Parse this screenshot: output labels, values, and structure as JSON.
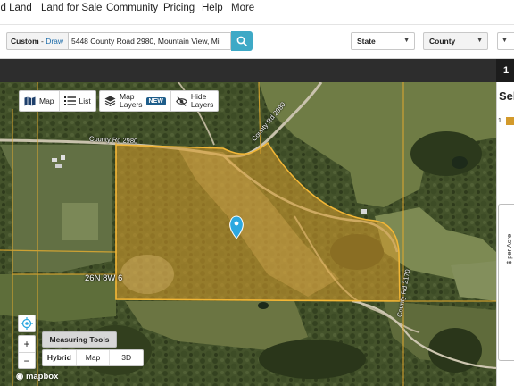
{
  "nav": {
    "links": [
      "ld Land",
      "Land for Sale",
      "Community",
      "Pricing",
      "Help",
      "More"
    ]
  },
  "search": {
    "mode_label": "Custom",
    "mode_sep": " - ",
    "mode_action": "Draw",
    "address_value": "5448 County Road 2980, Mountain View, Mi",
    "state_label": "State",
    "county_label": "County"
  },
  "top_strip": {
    "tab_label": "1"
  },
  "map": {
    "controls": {
      "map_label": "Map",
      "list_label": "List",
      "map_layers_line1": "Map",
      "map_layers_line2": "Layers",
      "new_badge": "NEW",
      "hide_layers_line1": "Hide",
      "hide_layers_line2": "Layers",
      "zoom_in": "+",
      "zoom_out": "−",
      "measuring_tools": "Measuring Tools",
      "map_types": [
        "Hybrid",
        "Map",
        "3D"
      ],
      "active_map_type": "Hybrid"
    },
    "labels": {
      "road_north": "County Rd 2980",
      "road_diagonal": "County Rd 2980",
      "road_east": "County Rd 2170",
      "township": "26N 8W 6"
    },
    "attribution": "mapbox",
    "colors": {
      "parcel_fill": "#d39a2b",
      "parcel_border": "#f2b636",
      "pin": "#2ba8e0"
    }
  },
  "panel": {
    "title": "Sel",
    "row_index": "1",
    "price_label": "$ per Acre"
  }
}
